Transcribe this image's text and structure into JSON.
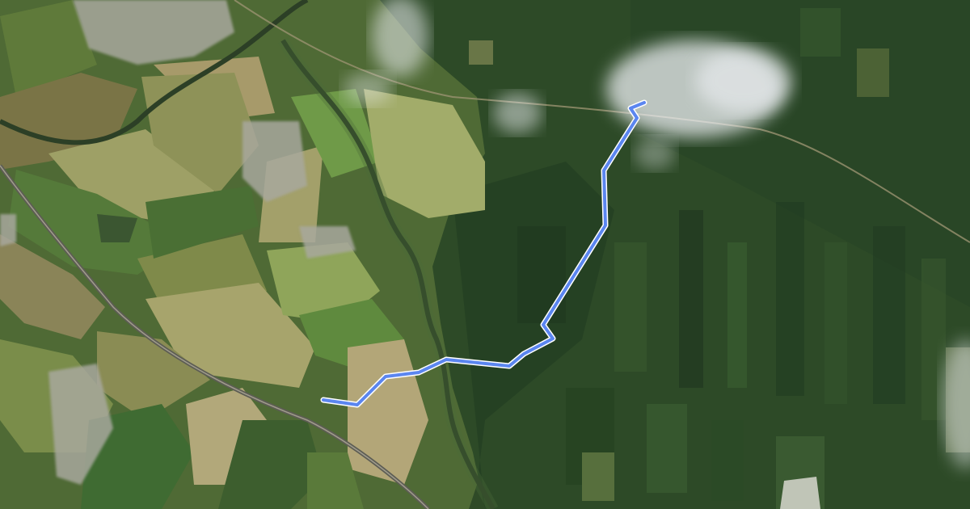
{
  "map": {
    "view": "satellite",
    "route": {
      "color": "#5b86f0",
      "outline_color": "#ffffff"
    },
    "colors": {
      "farmland_light": "#a8a868",
      "farmland_dark": "#6f7a3e",
      "forest": "#2c4a26",
      "forest_dark": "#1e3520",
      "river": "#33472a",
      "road": "#8c8a80",
      "village": "#9a9a8e",
      "cloud": "#e8ecf2"
    }
  }
}
